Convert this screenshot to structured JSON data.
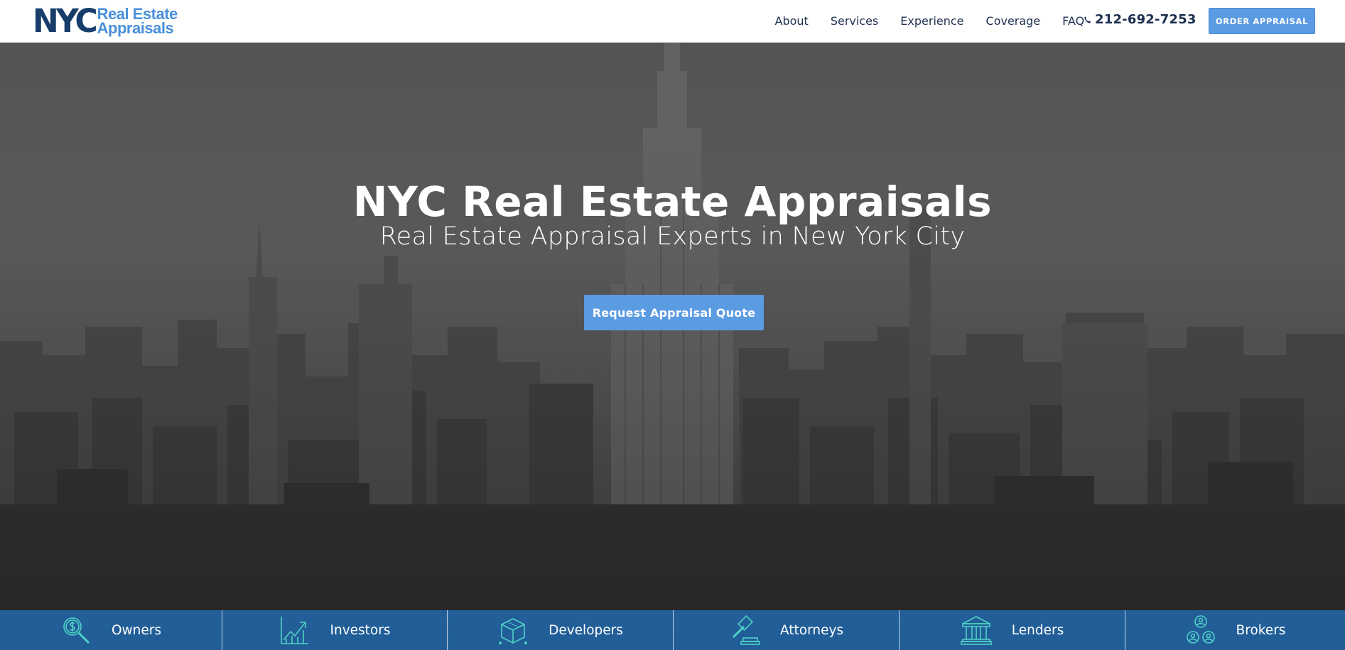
{
  "logo": {
    "primary": "NYC",
    "line1": "Real Estate",
    "line2": "Appraisals"
  },
  "nav": {
    "links": [
      "About",
      "Services",
      "Experience",
      "Coverage",
      "FAQ"
    ],
    "phone": "212-692-7253",
    "order_button": "ORDER APPRAISAL"
  },
  "hero": {
    "title": "NYC Real Estate Appraisals",
    "subtitle": "Real Estate Appraisal Experts in New York City",
    "cta": "Request Appraisal Quote"
  },
  "categories": [
    {
      "label": "Owners",
      "icon": "magnifier-dollar-icon"
    },
    {
      "label": "Investors",
      "icon": "growth-chart-icon"
    },
    {
      "label": "Developers",
      "icon": "cube-icon"
    },
    {
      "label": "Attorneys",
      "icon": "gavel-icon"
    },
    {
      "label": "Lenders",
      "icon": "bank-icon"
    },
    {
      "label": "Brokers",
      "icon": "people-network-icon"
    }
  ],
  "colors": {
    "brand_navy": "#173d6b",
    "brand_blue": "#4a90d9",
    "button_blue": "#5b9be2",
    "category_bar": "#216bb2",
    "icon_teal": "#4fd1c5"
  }
}
